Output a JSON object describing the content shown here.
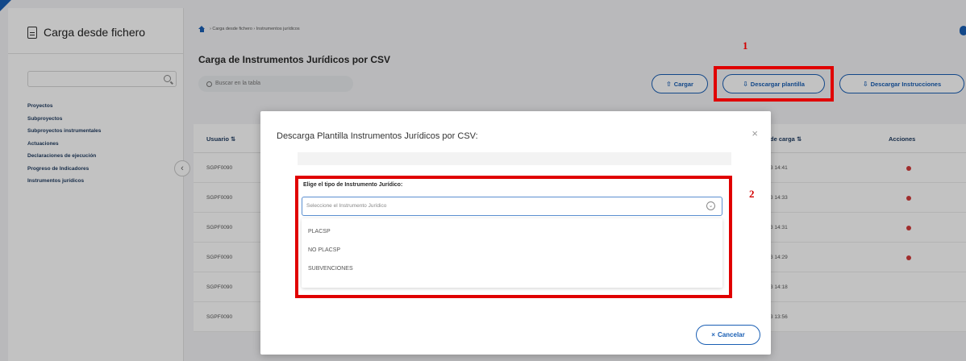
{
  "sidebar": {
    "title": "Carga desde fichero",
    "items": [
      {
        "label": "Proyectos"
      },
      {
        "label": "Subproyectos"
      },
      {
        "label": "Subproyectos instrumentales"
      },
      {
        "label": "Actuaciones"
      },
      {
        "label": "Declaraciones de ejecución"
      },
      {
        "label": "Progreso de Indicadores"
      },
      {
        "label": "Instrumentos jurídicos"
      }
    ],
    "toggle_glyph": "‹"
  },
  "main": {
    "breadcrumb": "› Carga desde fichero › Instrumentos jurídicos",
    "title": "Carga de Instrumentos Jurídicos por CSV",
    "search_placeholder": "Buscar en la tabla",
    "buttons": {
      "cargar": "Cargar",
      "descargar_plantilla": "Descargar plantilla",
      "descargar_instrucciones": "Descargar Instrucciones"
    },
    "table": {
      "headers": {
        "usuario": "Usuario",
        "fecha": "de carga",
        "acciones": "Acciones"
      },
      "rows": [
        {
          "usuario": "SGPF0090",
          "fecha": "3 14:41"
        },
        {
          "usuario": "SGPF0090",
          "fecha": "3 14:33"
        },
        {
          "usuario": "SGPF0090",
          "fecha": "3 14:31"
        },
        {
          "usuario": "SGPF0090",
          "fecha": "3 14:29"
        },
        {
          "usuario": "SGPF0090",
          "fecha": "3 14:18"
        },
        {
          "usuario": "SGPF0090",
          "fecha": "3 13:56"
        }
      ]
    }
  },
  "annotations": {
    "one": "1",
    "two": "2"
  },
  "modal": {
    "title": "Descarga Plantilla Instrumentos Jurídicos por CSV:",
    "close_glyph": "×",
    "field_label": "Elige el tipo de Instrumento Jurídico:",
    "select_placeholder": "Seleccione el Instrumento Jurídico",
    "options": [
      "PLACSP",
      "NO PLACSP",
      "SUBVENCIONES"
    ],
    "cancel_label": "Cancelar",
    "cancel_glyph": "×"
  },
  "colors": {
    "accent": "#1a5fb4",
    "annotation": "#e00000",
    "danger": "#d33c3c"
  }
}
